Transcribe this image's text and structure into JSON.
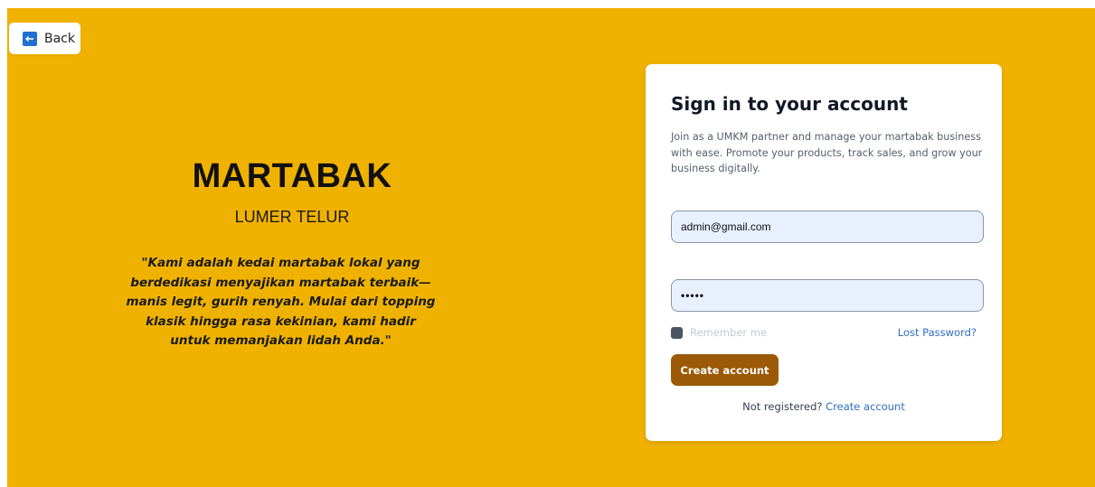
{
  "back_button": {
    "label": "Back",
    "icon": "arrow-left-icon"
  },
  "brand": {
    "title": "MARTABAK",
    "subtitle": "LUMER TELUR",
    "quote": "\"Kami adalah kedai martabak lokal yang berdedikasi menyajikan martabak terbaik—manis legit, gurih renyah. Mulai dari topping klasik hingga rasa kekinian, kami hadir untuk memanjakan lidah Anda.\""
  },
  "login_form": {
    "title": "Sign in to your account",
    "description": "Join as a UMKM partner and manage your martabak business with ease. Promote your products, track sales, and grow your business digitally.",
    "email_value": "admin@gmail.com",
    "password_value": "•••••",
    "remember_label": "Remember me",
    "lost_password_label": "Lost Password?",
    "submit_label": "Create account",
    "register_prompt": "Not registered?",
    "register_link_label": "Create account"
  },
  "colors": {
    "background": "#f0b200",
    "submit_button": "#9c5a06",
    "link": "#2f6fc1",
    "input_background": "#e8f0fe"
  }
}
